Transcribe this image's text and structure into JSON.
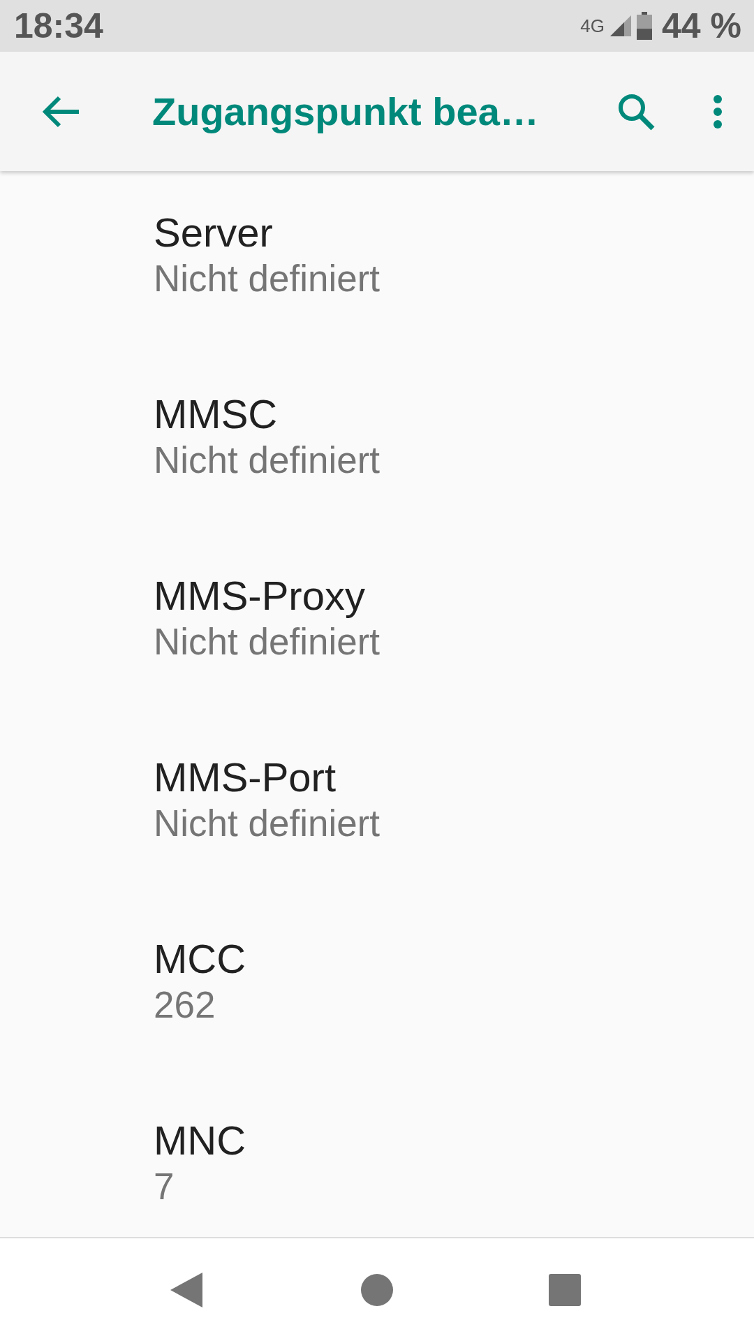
{
  "status_bar": {
    "time": "18:34",
    "network": "4G",
    "battery": "44 %"
  },
  "app_bar": {
    "title": "Zugangspunkt bea…"
  },
  "items": [
    {
      "title": "Server",
      "summary": "Nicht definiert"
    },
    {
      "title": "MMSC",
      "summary": "Nicht definiert"
    },
    {
      "title": "MMS-Proxy",
      "summary": "Nicht definiert"
    },
    {
      "title": "MMS-Port",
      "summary": "Nicht definiert"
    },
    {
      "title": "MCC",
      "summary": "262"
    },
    {
      "title": "MNC",
      "summary": "7"
    }
  ]
}
